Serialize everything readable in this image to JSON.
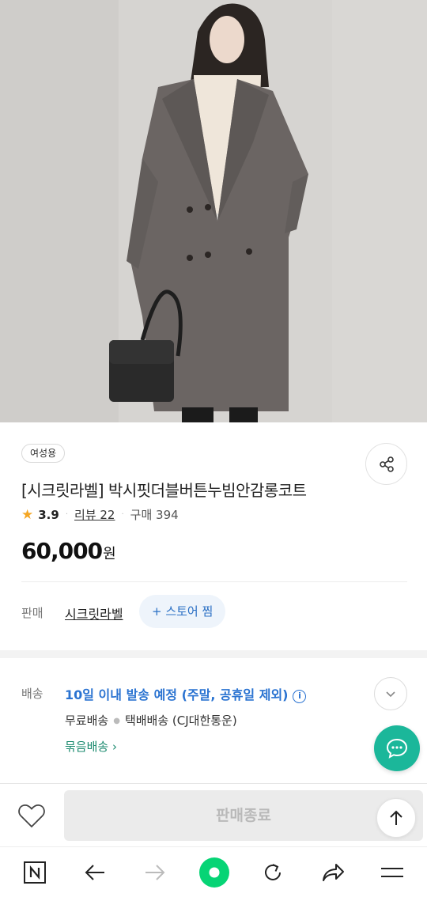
{
  "product": {
    "tag": "여성용",
    "title": "[시크릿라벨] 박시핏더블버튼누빔안감롱코트",
    "rating": "3.9",
    "review_label": "리뷰 22",
    "purchase_label": "구매 394",
    "price": "60,000",
    "price_unit": "원"
  },
  "seller": {
    "label": "판매",
    "name": "시크릿라벨",
    "store_button": "+ 스토어 찜"
  },
  "shipping": {
    "label": "배송",
    "date_text": "10일 이내 발송 예정 (주말, 공휴일 제외)",
    "method_1": "무료배송",
    "method_2": "택배배송 (CJ대한통운)",
    "bundle_link": "묶음배송 ›"
  },
  "buybar": {
    "soldout_label": "판매종료"
  },
  "icons": {
    "share": "share-icon",
    "chevron": "chevron-down-icon",
    "chat": "chat-bubble-icon",
    "heart": "heart-icon",
    "top": "arrow-up-icon",
    "nav": [
      "naver-n-icon",
      "back-arrow-icon",
      "forward-arrow-icon",
      "home-dot-icon",
      "refresh-icon",
      "share-forward-icon",
      "menu-icon"
    ]
  },
  "colors": {
    "accent_blue": "#2a73d1",
    "accent_green": "#1bb79a",
    "star": "#f5a623"
  }
}
